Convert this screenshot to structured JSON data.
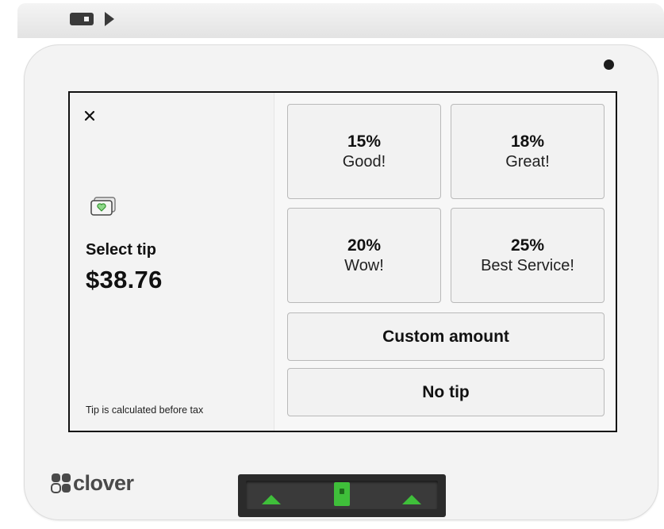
{
  "brand": {
    "name": "clover"
  },
  "screen": {
    "select_label": "Select tip",
    "total_amount": "$38.76",
    "footnote": "Tip is calculated before tax",
    "tip_options": [
      {
        "percent": "15%",
        "label": "Good!"
      },
      {
        "percent": "18%",
        "label": "Great!"
      },
      {
        "percent": "20%",
        "label": "Wow!"
      },
      {
        "percent": "25%",
        "label": "Best Service!"
      }
    ],
    "custom_amount_label": "Custom amount",
    "no_tip_label": "No tip"
  },
  "icons": {
    "close": "close-icon",
    "tip": "cash-heart-icon",
    "card_slot": "card-insert-icon",
    "reader_arrows": "arrow-up-icon"
  },
  "colors": {
    "accent_green": "#3fbf3a",
    "screen_bg": "#f7f7f7",
    "device_body": "#f3f3f3"
  }
}
